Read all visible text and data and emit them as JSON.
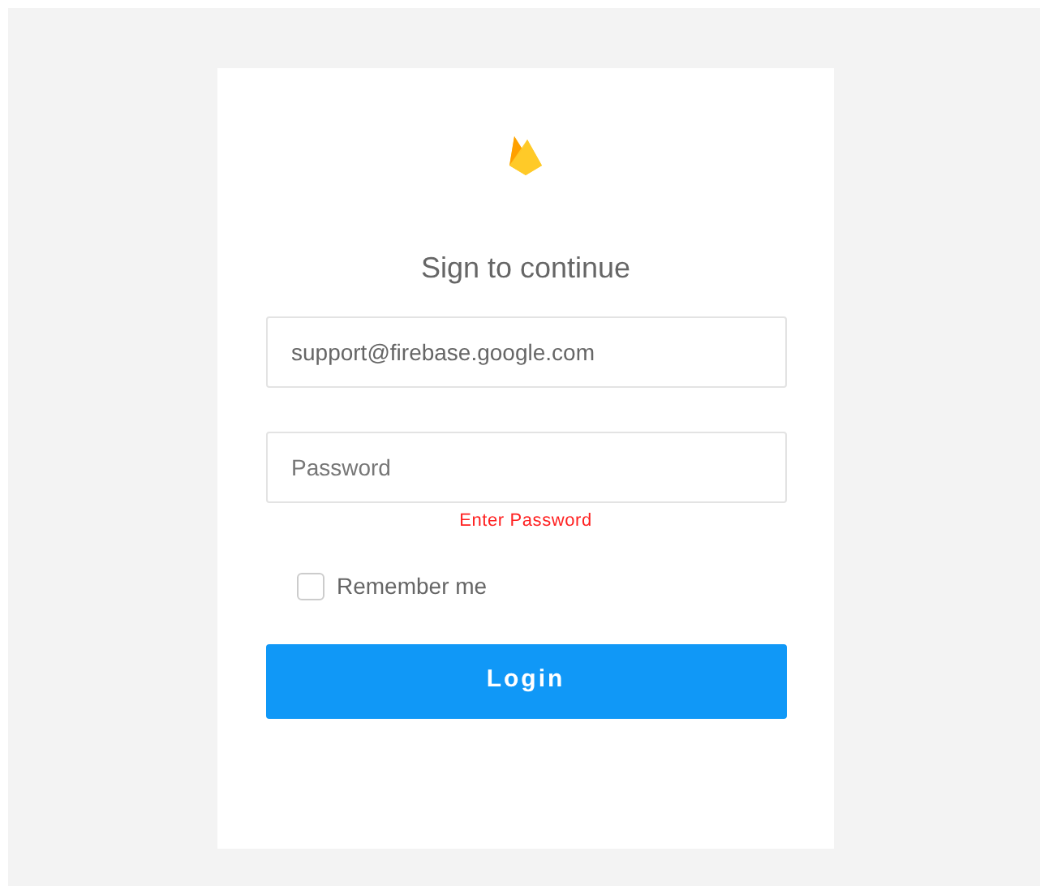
{
  "title": "Sign to continue",
  "email": {
    "value": "support@firebase.google.com"
  },
  "password": {
    "placeholder": "Password",
    "error": "Enter Password"
  },
  "remember": {
    "label": "Remember me",
    "checked": false
  },
  "button": "Login"
}
